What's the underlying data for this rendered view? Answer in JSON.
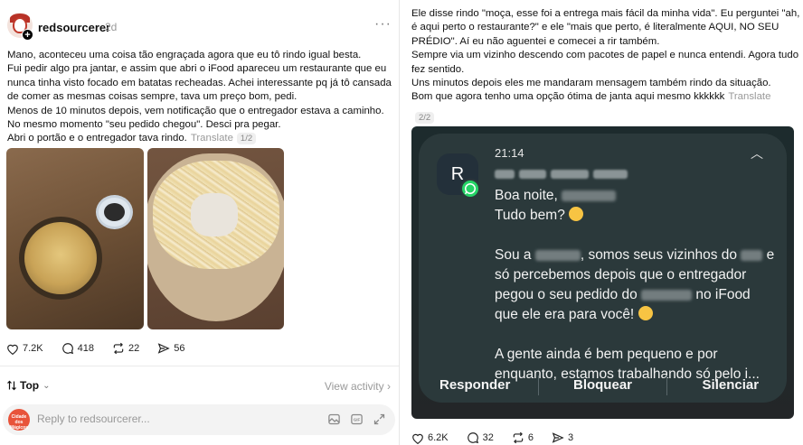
{
  "left_post": {
    "username": "redsourcerer",
    "time": "2d",
    "paragraphs": [
      "Mano, aconteceu uma coisa tão engraçada agora que eu tô rindo igual besta.",
      "Fui pedir algo pra jantar, e assim que abri o iFood apareceu um restaurante que eu nunca tinha visto focado em batatas recheadas. Achei interessante pq já tô cansada de comer as mesmas coisas sempre, tava um preço bom, pedi.",
      "Menos de 10 minutos depois, vem notificação que o entregador estava a caminho. No mesmo momento \"seu pedido chegou\". Desci pra pegar.",
      "Abri o portão e o entregador tava rindo."
    ],
    "translate_label": "Translate",
    "pager": "1/2",
    "likes": "7.2K",
    "comments": "418",
    "reposts": "22",
    "shares": "56"
  },
  "sort": {
    "label": "Top",
    "view_activity": "View activity"
  },
  "reply": {
    "placeholder": "Reply to redsourcerer...",
    "avatar_text": "Cidade dos Mágicos"
  },
  "right_post": {
    "paragraphs": [
      "Ele disse rindo \"moça, esse foi a entrega mais fácil da minha vida\". Eu perguntei \"ah, é aqui perto o restaurante?\" e ele \"mais que perto, é literalmente AQUI, NO SEU PRÉDIO\". Aí eu não aguentei e comecei a rir também.",
      "Sempre via um vizinho descendo com pacotes de papel e nunca entendi. Agora tudo fez sentido.",
      "Uns minutos depois eles me mandaram mensagem também rindo da situação.",
      "Bom que agora tenho uma opção ótima de janta aqui mesmo kkkkkk"
    ],
    "translate_label": "Translate",
    "pager": "2/2",
    "likes": "6.2K",
    "comments": "32",
    "reposts": "6",
    "shares": "3"
  },
  "notification": {
    "app_initial": "R",
    "time": "21:14",
    "greeting": "Boa noite,",
    "line2": "Tudo bem?",
    "body1_a": "Sou a",
    "body1_b": ", somos seus vizinhos do",
    "body1_c": "e só percebemos depois que o entregador pegou o seu pedido do",
    "body1_d": "no iFood que ele era para você!",
    "body2": "A gente ainda é bem pequeno e por enquanto, estamos trabalhando só pelo i...",
    "actions": [
      "Responder",
      "Bloquear",
      "Silenciar"
    ]
  },
  "colors": {
    "whatsapp": "#25d366",
    "notification_bg": "#2b393b",
    "accent_avatar": "#e8533a"
  }
}
